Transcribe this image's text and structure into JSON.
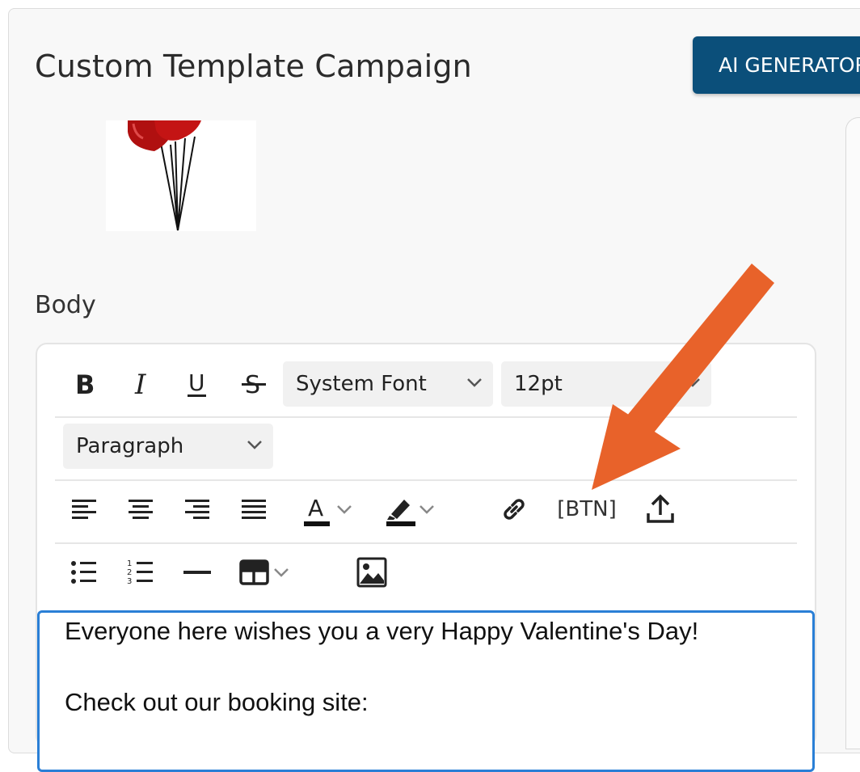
{
  "page": {
    "title": "Custom Template Campaign"
  },
  "header": {
    "ai_button_label": "AI GENERATOR"
  },
  "image": {
    "icon": "heart-balloons"
  },
  "body_section": {
    "label": "Body"
  },
  "toolbar": {
    "font_family": "System Font",
    "font_size": "12pt",
    "block_format": "Paragraph",
    "button_insert_label": "[BTN]",
    "icons": [
      "bold",
      "italic",
      "underline",
      "strikethrough",
      "align-left",
      "align-center",
      "align-right",
      "align-justify",
      "text-color",
      "highlight",
      "link",
      "upload",
      "bullet-list",
      "numbered-list",
      "horizontal-rule",
      "table",
      "image"
    ]
  },
  "editor": {
    "line1": "Everyone here wishes you a very Happy Valentine's Day!",
    "line2": "Check out our booking site:"
  },
  "colors": {
    "accent": "#0b4f7a",
    "focus": "#2a7fd6",
    "annotation_arrow": "#e8622a"
  }
}
